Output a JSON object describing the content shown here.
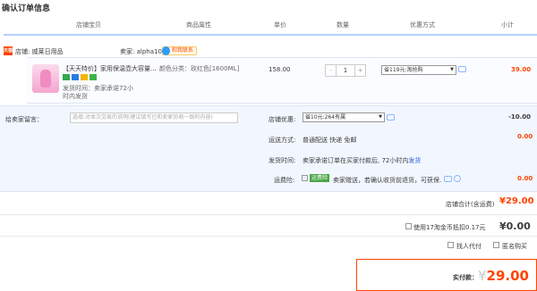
{
  "page": {
    "title": "确认订单信息"
  },
  "columns": [
    "店铺宝贝",
    "商品属性",
    "单价",
    "数量",
    "优惠方式",
    "小计"
  ],
  "shop": {
    "badge": "天猫",
    "label": "店铺: 威莱日用品",
    "seller_label": "卖家: alpha108",
    "contact_label": "和我联系"
  },
  "item": {
    "title": "【天天特价】家用保温壶大容量...",
    "sku": "颜色分类：玫红色[1600ML]",
    "note": "发货时间：卖家承诺72小时内发货",
    "price": "158.00",
    "quantity": "1",
    "minus": "-",
    "plus": "+",
    "promo": "省119元:淘抢购",
    "subtotal": "39.00",
    "tag_colors": [
      "#34a853",
      "#2a7be4",
      "#f4b400",
      "#3db34a"
    ]
  },
  "message": {
    "label": "给卖家留言：",
    "placeholder": "选填:对本次交易的说明(建议填写已和卖家协商一致的内容)"
  },
  "options": {
    "shop_discount_label": "店铺优惠:",
    "shop_discount_select": "省10元:264有属",
    "shop_discount_value": "-10.00",
    "shipping_label": "运送方式:",
    "shipping_text": "普通配送 快递 免邮",
    "shipping_value": "0.00",
    "delivery_label": "发货时间:",
    "delivery_text": "卖家承诺订单在买家付款后, 72小时内",
    "delivery_link": "发货",
    "insurance_label": "运费险:",
    "insurance_badge": "运费险",
    "insurance_text": "卖家赠送，若确认收货前退货，可获保...",
    "insurance_value": "0.00"
  },
  "totals": {
    "shop_total_label": "店铺合计(含运费)",
    "shop_total_value": "¥29.00",
    "coin_label": "使用17淘金币抵扣0.17元",
    "coin_value": "¥0.00",
    "proxy_pay": "找人代付",
    "anonymous": "匿名购买",
    "final_label": "实付款：",
    "final_currency": "¥",
    "final_value": "29.00"
  }
}
